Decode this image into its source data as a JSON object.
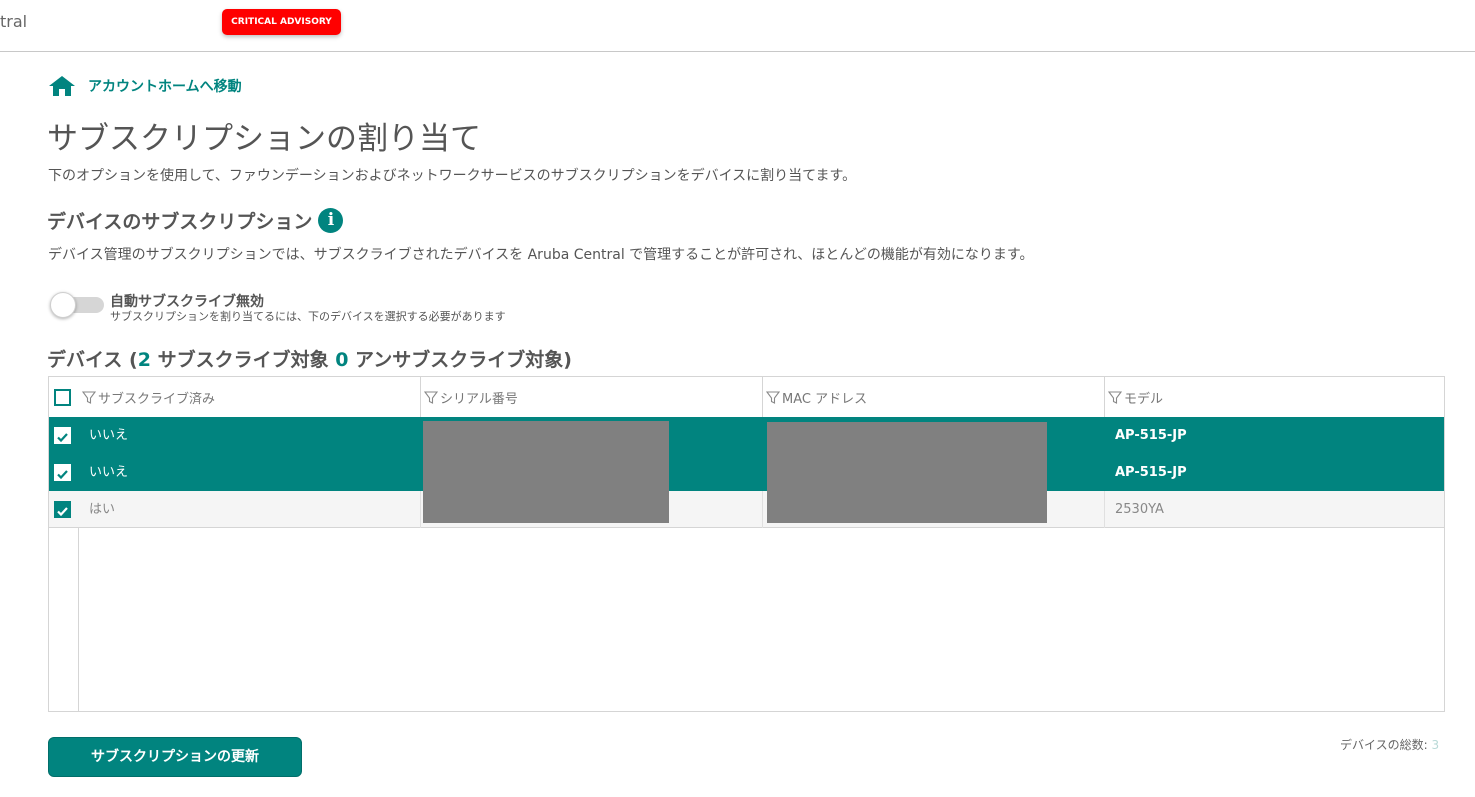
{
  "header": {
    "brand_fragment": "tral",
    "advisory_label": "CRITICAL ADVISORY"
  },
  "breadcrumb": {
    "home_label": "アカウントホームへ移動",
    "icon": "home-icon"
  },
  "page": {
    "title": "サブスクリプションの割り当て",
    "description": "下のオプションを使用して、ファウンデーションおよびネットワークサービスのサブスクリプションをデバイスに割り当てます。"
  },
  "device_subscription": {
    "title": "デバイスのサブスクリプション",
    "info_icon": "i",
    "description": "デバイス管理のサブスクリプションでは、サブスクライブされたデバイスを Aruba Central で管理することが許可され、ほとんどの機能が有効になります。"
  },
  "auto_subscribe": {
    "label": "自動サブスクライブ無効",
    "sublabel": "サブスクリプションを割り当てるには、下のデバイスを選択する必要があります",
    "enabled": false
  },
  "devices_heading": {
    "prefix": "デバイス (",
    "subscribable_count": "2",
    "subscribable_label": " サブスクライブ対象 ",
    "unsubscribable_count": "0",
    "unsubscribable_label": " アンサブスクライブ対象)"
  },
  "table": {
    "columns": [
      "サブスクライブ済み",
      "シリアル番号",
      "MAC アドレス",
      "モデル"
    ],
    "rows": [
      {
        "subscribed": "いいえ",
        "model": "AP-515-JP",
        "checked": true,
        "selected": true
      },
      {
        "subscribed": "いいえ",
        "model": "AP-515-JP",
        "checked": true,
        "selected": true
      },
      {
        "subscribed": "はい",
        "model": "2530YA",
        "checked": true,
        "selected": false
      }
    ]
  },
  "footer": {
    "update_button": "サブスクリプションの更新",
    "total_label": "デバイスの総数: ",
    "total_count": "3"
  },
  "colors": {
    "accent": "#01847f",
    "advisory": "#ff0000",
    "redaction": "#808080"
  }
}
